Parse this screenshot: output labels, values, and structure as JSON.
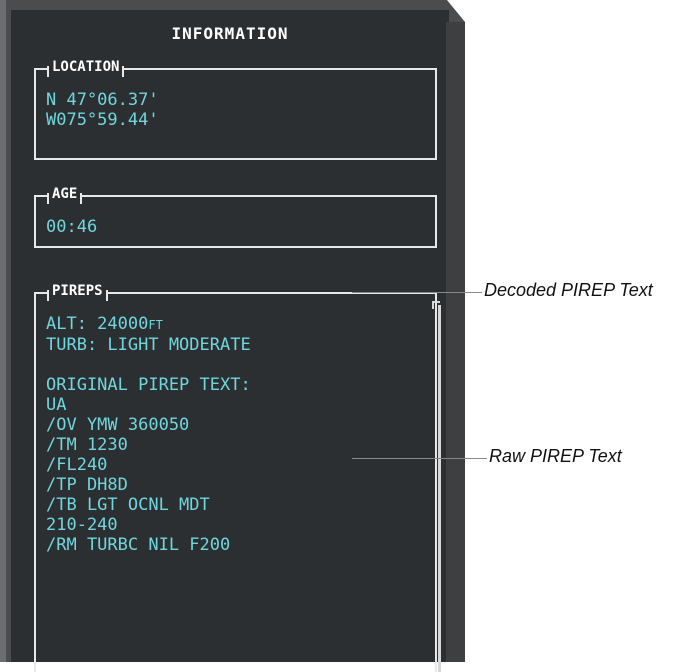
{
  "window": {
    "title": "INFORMATION"
  },
  "location": {
    "label": "LOCATION",
    "lat": "N 47°06.37'",
    "lon": "W075°59.44'"
  },
  "age": {
    "label": "AGE",
    "value": "00:46"
  },
  "pireps": {
    "label": "PIREPS",
    "alt_prefix": "ALT: 24000",
    "alt_unit": "FT",
    "lines": [
      "TURB: LIGHT MODERATE",
      "",
      "ORIGINAL PIREP TEXT:",
      "UA",
      "/OV YMW 360050",
      "/TM 1230",
      "/FL240",
      "/TP DH8D",
      "/TB LGT OCNL MDT",
      "210-240",
      "/RM TURBC NIL F200"
    ]
  },
  "callouts": {
    "decoded": "Decoded PIREP Text",
    "raw": "Raw PIREP Text"
  },
  "colors": {
    "text_cyan": "#6fd6de",
    "panel_bg": "#2c2f31",
    "bezel": "#4a4c4e"
  }
}
